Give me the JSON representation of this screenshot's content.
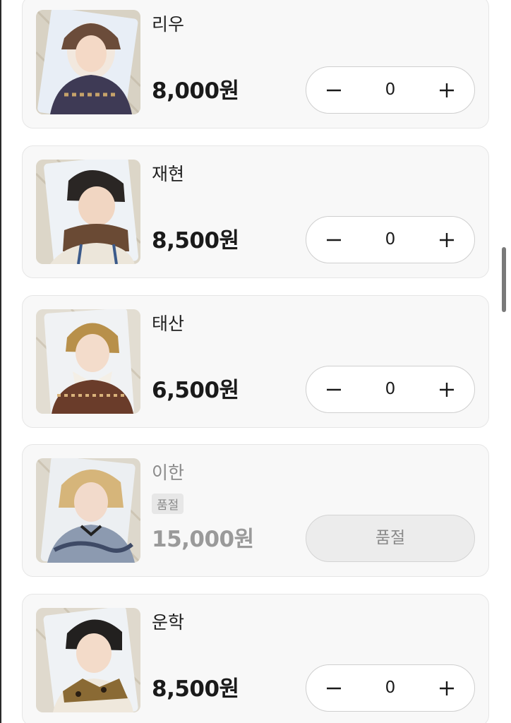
{
  "products": [
    {
      "name": "리우",
      "price": "8,000원",
      "quantity": "0",
      "sold_out": false
    },
    {
      "name": "재현",
      "price": "8,500원",
      "quantity": "0",
      "sold_out": false
    },
    {
      "name": "태산",
      "price": "6,500원",
      "quantity": "0",
      "sold_out": false
    },
    {
      "name": "이한",
      "price": "15,000원",
      "sold_out": true,
      "sold_out_badge": "품절",
      "sold_out_button": "품절"
    },
    {
      "name": "운학",
      "price": "8,500원",
      "quantity": "0",
      "sold_out": false
    }
  ],
  "icons": {
    "decrease": "minus-icon",
    "increase": "plus-icon"
  },
  "colors": {
    "card_background": "#f8f8f8",
    "sold_out_text": "#8a8a8a",
    "stepper_border": "#cfcfcf"
  }
}
